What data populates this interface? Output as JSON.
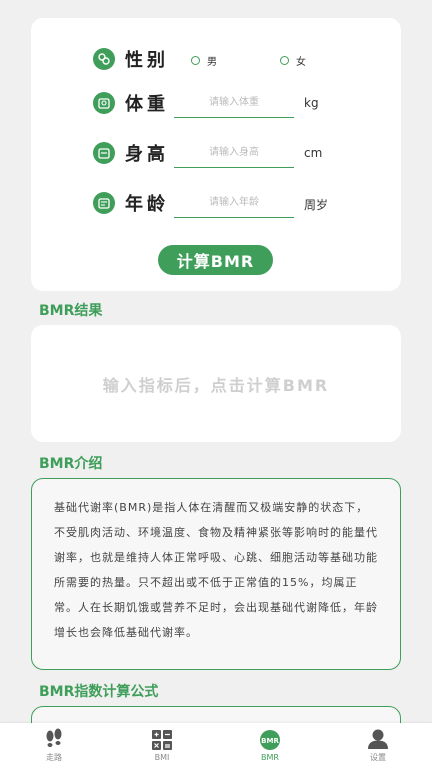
{
  "form": {
    "gender": {
      "label": "性别",
      "options": [
        "男",
        "女"
      ]
    },
    "weight": {
      "label": "体重",
      "placeholder": "请输入体重",
      "unit": "kg"
    },
    "height": {
      "label": "身高",
      "placeholder": "请输入身高",
      "unit": "cm"
    },
    "age": {
      "label": "年龄",
      "placeholder": "请输入年龄",
      "unit": "周岁"
    },
    "calc_button": "计算BMR"
  },
  "result": {
    "title": "BMR结果",
    "placeholder": "输入指标后，点击计算BMR"
  },
  "intro": {
    "title": "BMR介绍",
    "text": "基础代谢率(BMR)是指人体在清醒而又极端安静的状态下，不受肌肉活动、环境温度、食物及精神紧张等影响时的能量代谢率，也就是维持人体正常呼吸、心跳、细胞活动等基础功能所需要的热量。只不超出或不低于正常值的15%，均属正常。人在长期饥饿或营养不足时，会出现基础代谢降低，年龄增长也会降低基础代谢率。"
  },
  "formula": {
    "title": "BMR指数计算公式"
  },
  "tabbar": {
    "tabs": [
      {
        "label": "走路",
        "icon": "footprints-icon"
      },
      {
        "label": "BMI",
        "icon": "calculator-icon"
      },
      {
        "label": "BMR",
        "icon": "bmr-icon"
      },
      {
        "label": "设置",
        "icon": "user-icon"
      }
    ],
    "active_color": "#3f9e5a"
  },
  "colors": {
    "accent": "#3f9e5a",
    "background": "#f0f0f0"
  }
}
